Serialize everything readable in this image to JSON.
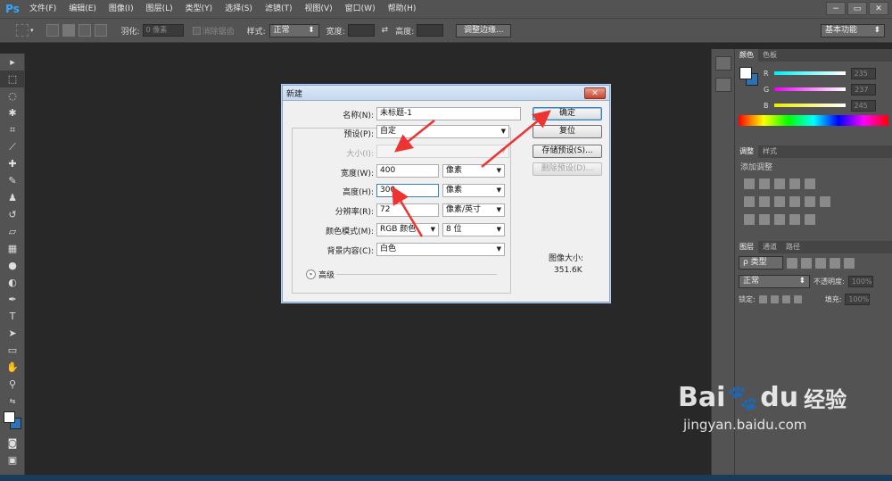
{
  "app": {
    "logo": "Ps",
    "menu": [
      "文件(F)",
      "编辑(E)",
      "图像(I)",
      "图层(L)",
      "类型(Y)",
      "选择(S)",
      "滤镜(T)",
      "视图(V)",
      "窗口(W)",
      "帮助(H)"
    ],
    "window_controls": [
      "−",
      "▭",
      "✕"
    ]
  },
  "options_bar": {
    "feather_label": "羽化:",
    "feather_value": "0 像素",
    "antialias_label": "消除锯齿",
    "style_label": "样式:",
    "style_value": "正常",
    "width_label": "宽度:",
    "height_label": "高度:",
    "refine_edge": "调整边缘...",
    "workspace": "基本功能"
  },
  "dialog": {
    "title": "新建",
    "name_label": "名称(N):",
    "name_value": "未标题-1",
    "preset_label": "预设(P):",
    "preset_value": "自定",
    "size_label": "大小(I):",
    "width_label": "宽度(W):",
    "width_value": "400",
    "width_unit": "像素",
    "height_label": "高度(H):",
    "height_value": "300",
    "height_unit": "像素",
    "resolution_label": "分辨率(R):",
    "resolution_value": "72",
    "resolution_unit": "像素/英寸",
    "color_mode_label": "颜色模式(M):",
    "color_mode_value": "RGB 颜色",
    "bit_depth": "8 位",
    "background_label": "背景内容(C):",
    "background_value": "白色",
    "advanced": "高级",
    "ok": "确定",
    "reset": "复位",
    "save_preset": "存储预设(S)...",
    "delete_preset": "删除预设(D)...",
    "image_size_label": "图像大小:",
    "image_size_value": "351.6K"
  },
  "color_panel": {
    "tabs": [
      "颜色",
      "色板"
    ],
    "r_label": "R",
    "g_label": "G",
    "b_label": "B",
    "r_value": "235",
    "g_value": "237",
    "b_value": "245"
  },
  "adjust_panel": {
    "tabs": [
      "调整",
      "样式"
    ],
    "title": "添加调整"
  },
  "layers_panel": {
    "tabs": [
      "图层",
      "通道",
      "路径"
    ],
    "kind": "ρ 类型",
    "blend": "正常",
    "opacity_label": "不透明度:",
    "opacity_value": "100%",
    "lock_label": "锁定:",
    "fill_label": "填充:",
    "fill_value": "100%"
  },
  "watermark": {
    "brand": "Bai",
    "brand2": "du",
    "jingyan": "经验",
    "url": "jingyan.baidu.com"
  },
  "colors": {
    "accent": "#31a8ff",
    "arrow": "#ee3333"
  }
}
